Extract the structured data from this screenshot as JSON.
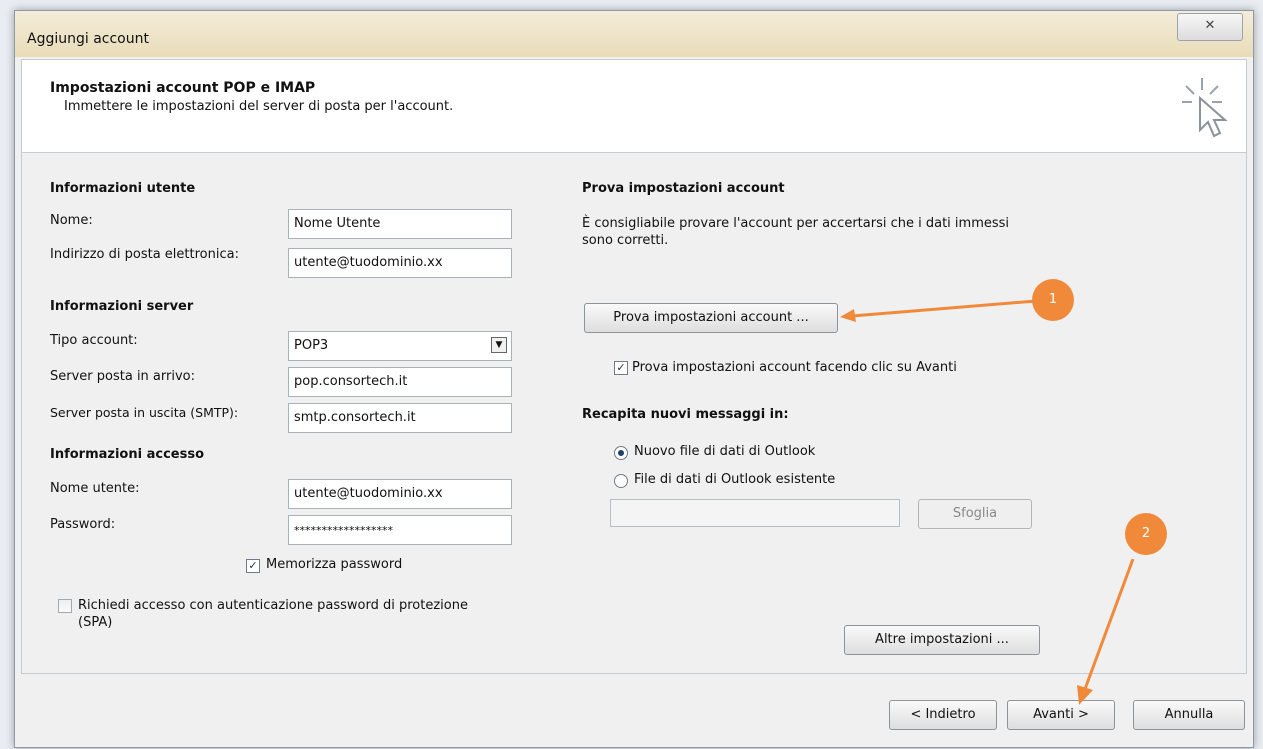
{
  "window": {
    "title": "Aggiungi account",
    "close_glyph": "✕"
  },
  "header": {
    "title": "Impostazioni account POP e IMAP",
    "subtitle": "Immettere le impostazioni del server di posta per l'account."
  },
  "user_info": {
    "section": "Informazioni utente",
    "name_label": "Nome:",
    "name_value": "Nome Utente",
    "email_label": "Indirizzo di posta elettronica:",
    "email_value": "utente@tuodominio.xx"
  },
  "server_info": {
    "section": "Informazioni server",
    "account_type_label": "Tipo account:",
    "account_type_value": "POP3",
    "incoming_label": "Server posta in arrivo:",
    "incoming_value": "pop.consortech.it",
    "outgoing_label": "Server posta in uscita (SMTP):",
    "outgoing_value": "smtp.consortech.it"
  },
  "login_info": {
    "section": "Informazioni accesso",
    "username_label": "Nome utente:",
    "username_value": "utente@tuodominio.xx",
    "password_label": "Password:",
    "password_value": "******************",
    "remember_label": "Memorizza password",
    "remember_checked": true,
    "spa_label": "Richiedi accesso con autenticazione password di protezione (SPA)",
    "spa_checked": false
  },
  "test_settings": {
    "section": "Prova impostazioni account",
    "description": "È consigliabile provare l'account per accertarsi che i dati immessi sono corretti.",
    "button": "Prova impostazioni account ...",
    "auto_test_label": "Prova impostazioni account facendo clic su Avanti",
    "auto_test_checked": true
  },
  "deliver": {
    "section": "Recapita nuovi messaggi in:",
    "option_new": "Nuovo file di dati di Outlook",
    "option_existing": "File di dati di Outlook esistente",
    "selected": "new",
    "browse_button": "Sfoglia",
    "path_value": ""
  },
  "more_settings_button": "Altre impostazioni ...",
  "footer": {
    "back": "< Indietro",
    "next": "Avanti >",
    "cancel": "Annulla"
  },
  "annotations": {
    "badge_1": "1",
    "badge_2": "2",
    "color": "#f08a3a"
  }
}
